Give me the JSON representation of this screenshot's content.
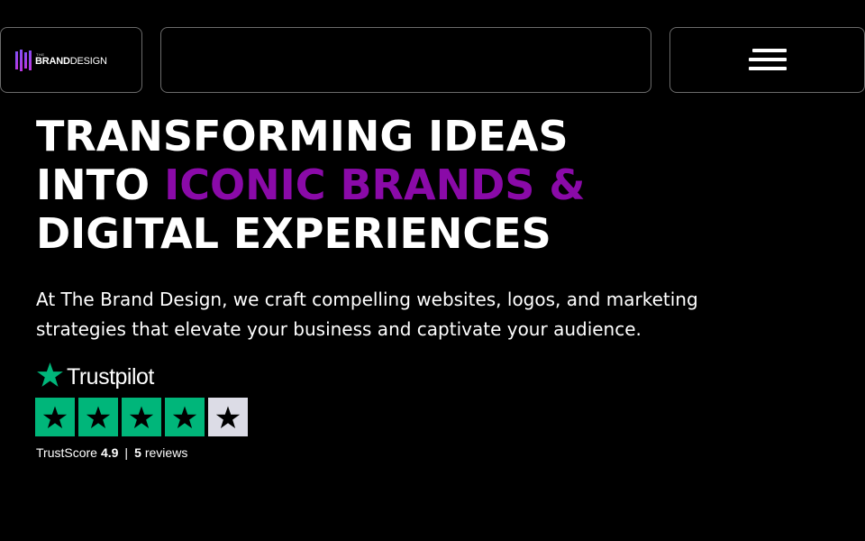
{
  "header": {
    "logo": {
      "small_text": "THE",
      "brand_bold": "BRAND",
      "brand_thin": "DESIGN"
    },
    "menu_icon": "hamburger-icon"
  },
  "hero": {
    "line1": "TRANSFORMING IDEAS",
    "line2_prefix": "INTO ",
    "line2_accent": "ICONIC BRANDS &",
    "line3": "DIGITAL EXPERIENCES",
    "description": "At The Brand Design, we craft compelling websites, logos, and marketing strategies that elevate your business and captivate your audience."
  },
  "trustpilot": {
    "name": "Trustpilot",
    "stars_filled": 4,
    "stars_total": 5,
    "score_label": "TrustScore",
    "score_value": "4.9",
    "separator": "|",
    "reviews_count": "5",
    "reviews_label": "reviews"
  },
  "colors": {
    "background": "#000000",
    "accent": "#8a0aa8",
    "trustpilot_green": "#00b67a",
    "empty_star_bg": "#dcdce6"
  }
}
